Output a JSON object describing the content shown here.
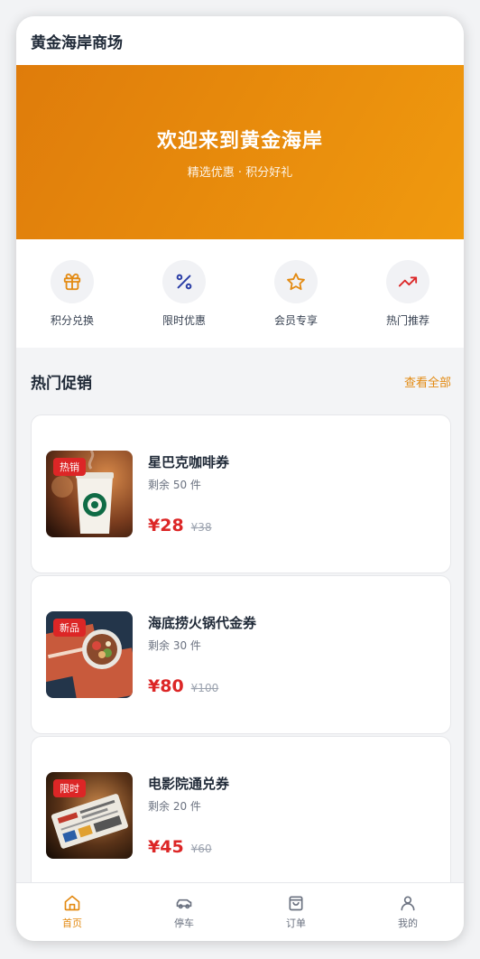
{
  "header": {
    "title": "黄金海岸商场"
  },
  "banner": {
    "title": "欢迎来到黄金海岸",
    "subtitle": "精选优惠 · 积分好礼"
  },
  "quick_actions": [
    {
      "label": "积分兑换",
      "icon": "gift-icon",
      "color": "#e38a12"
    },
    {
      "label": "限时优惠",
      "icon": "percent-icon",
      "color": "#2b3ea6"
    },
    {
      "label": "会员专享",
      "icon": "star-icon",
      "color": "#e38a12"
    },
    {
      "label": "热门推荐",
      "icon": "trending-up-icon",
      "color": "#dc2626"
    }
  ],
  "promotions": {
    "title": "热门促销",
    "more_label": "查看全部",
    "items": [
      {
        "tag": "热销",
        "name": "星巴克咖啡券",
        "stock": "剩余 50 件",
        "price": "¥28",
        "original_price": "¥38"
      },
      {
        "tag": "新品",
        "name": "海底捞火锅代金券",
        "stock": "剩余 30 件",
        "price": "¥80",
        "original_price": "¥100"
      },
      {
        "tag": "限时",
        "name": "电影院通兑券",
        "stock": "剩余 20 件",
        "price": "¥45",
        "original_price": "¥60"
      }
    ]
  },
  "tabbar": {
    "active": "首页",
    "tabs": [
      {
        "label": "首页",
        "icon": "home-icon"
      },
      {
        "label": "停车",
        "icon": "car-icon"
      },
      {
        "label": "订单",
        "icon": "shopping-bag-icon"
      },
      {
        "label": "我的",
        "icon": "user-icon"
      }
    ]
  },
  "colors": {
    "accent": "#e38a12",
    "price": "#dc2626",
    "banner_start": "#df7c0b",
    "banner_end": "#f09a0e"
  }
}
